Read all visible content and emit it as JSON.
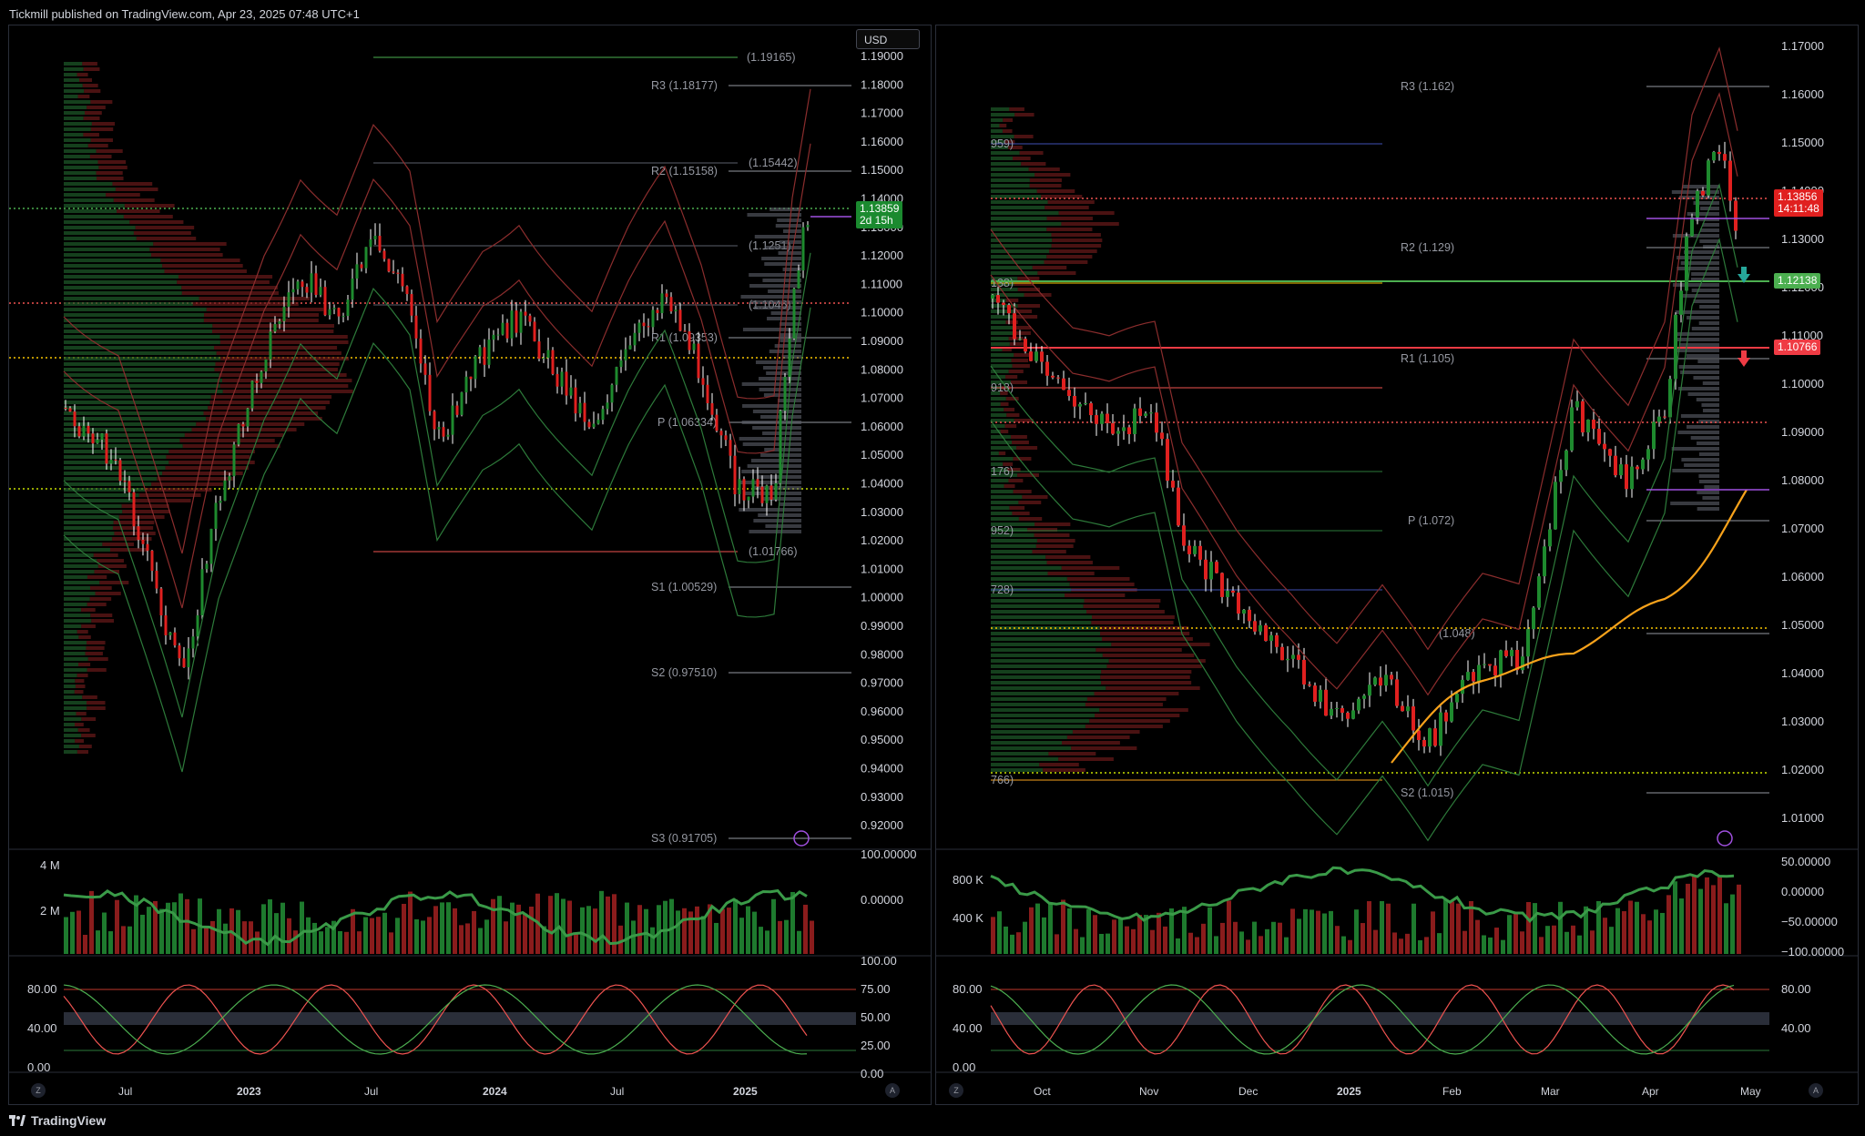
{
  "header": {
    "published": "Tickmill published on TradingView.com, Apr 23, 2025 07:48 UTC+1"
  },
  "footer": {
    "brand": "TradingView",
    "logo_icon": "tradingview-logo-icon"
  },
  "colors": {
    "bull": "#26a69a",
    "bear": "#ef5350",
    "green_candle": "#1e8a2e",
    "red_candle": "#e0201f",
    "wick": "#ffffff",
    "ema": "#f7a21b"
  },
  "left_chart": {
    "currency": "USD",
    "price_labels": [
      "1.19000",
      "1.18000",
      "1.17000",
      "1.16000",
      "1.15000",
      "1.14000",
      "1.13000",
      "1.12000",
      "1.11000",
      "1.10000",
      "1.09000",
      "1.08000",
      "1.07000",
      "1.06000",
      "1.05000",
      "1.04000",
      "1.03000",
      "1.02000",
      "1.01000",
      "1.00000",
      "0.99000",
      "0.98000",
      "0.97000",
      "0.96000",
      "0.95000",
      "0.94000",
      "0.93000",
      "0.92000"
    ],
    "levels": [
      "(1.19165)",
      "R3 (1.18177)",
      "(1.15442)",
      "R2 (1.15158)",
      "(1.1251)",
      "(1.1046)",
      "R1 (1.09353)",
      "P (1.06334)",
      "(1.01766)",
      "S1 (1.00529)",
      "S2 (0.97510)",
      "S3 (0.91705)"
    ],
    "last_price": "1.13859",
    "countdown": "2d 15h",
    "volume_labels": [
      "4 M",
      "2 M"
    ],
    "osc1_labels": [
      "100.00000",
      "0.00000"
    ],
    "osc2_left_labels": [
      "80.00",
      "40.00",
      "0.00"
    ],
    "osc2_right_labels": [
      "100.00",
      "75.00",
      "50.00",
      "25.00",
      "0.00"
    ],
    "time_labels": [
      "Jul",
      "2023",
      "Jul",
      "2024",
      "Jul",
      "2025"
    ],
    "zoom_label": "Z",
    "auto_label": "A"
  },
  "right_chart": {
    "price_labels": [
      "1.17000",
      "1.16000",
      "1.15000",
      "1.14000",
      "1.13000",
      "1.12000",
      "1.11000",
      "1.10000",
      "1.09000",
      "1.08000",
      "1.07000",
      "1.06000",
      "1.05000",
      "1.04000",
      "1.03000",
      "1.02000",
      "1.01000"
    ],
    "levels": [
      "R3 (1.162)",
      "R2 (1.129)",
      "R1 (1.105)",
      "P (1.072)",
      "(1.048)",
      "S2 (1.015)"
    ],
    "fib_labels": [
      "959)",
      "138)",
      "918)",
      "176)",
      "952)",
      "728)",
      "766)"
    ],
    "last_price": "1.13856",
    "countdown": "14:11:48",
    "box_green": "1.12138",
    "box_red": "1.10766",
    "volume_labels": [
      "800 K",
      "400 K"
    ],
    "osc1_labels": [
      "50.00000",
      "0.00000",
      "−50.00000",
      "−100.00000"
    ],
    "osc2_left_labels": [
      "80.00",
      "40.00",
      "0.00"
    ],
    "osc2_right_labels": [
      "80.00",
      "40.00"
    ],
    "time_labels": [
      "Oct",
      "Nov",
      "Dec",
      "2025",
      "Feb",
      "Mar",
      "Apr",
      "May"
    ],
    "zoom_label": "Z",
    "auto_label": "A"
  }
}
